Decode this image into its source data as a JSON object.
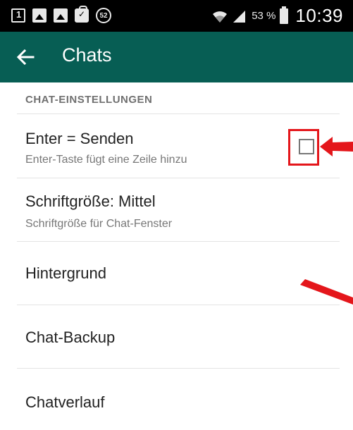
{
  "status_bar": {
    "notification_count": "52",
    "battery_percent": "53 %",
    "time": "10:39",
    "icons": [
      "notification-1-icon",
      "gallery-icon",
      "image-message-icon",
      "shopping-bag-icon",
      "badge-52-icon",
      "wifi-icon",
      "signal-icon",
      "battery-icon"
    ]
  },
  "app_bar": {
    "title": "Chats",
    "background_color": "#075e54",
    "back_icon": "arrow-left-icon"
  },
  "section": {
    "header": "CHAT-EINSTELLUNGEN"
  },
  "settings": [
    {
      "title": "Enter = Senden",
      "subtitle": "Enter-Taste fügt eine Zeile hinzu",
      "checkbox_checked": false
    },
    {
      "title": "Schriftgröße: Mittel",
      "subtitle": "Schriftgröße für Chat-Fenster"
    },
    {
      "title": "Hintergrund"
    },
    {
      "title": "Chat-Backup"
    },
    {
      "title": "Chatverlauf"
    }
  ],
  "annotations": {
    "highlight_color": "#e4161b",
    "marks": [
      "red-highlight-box",
      "red-arrow-icon",
      "red-stroke-mark"
    ]
  }
}
